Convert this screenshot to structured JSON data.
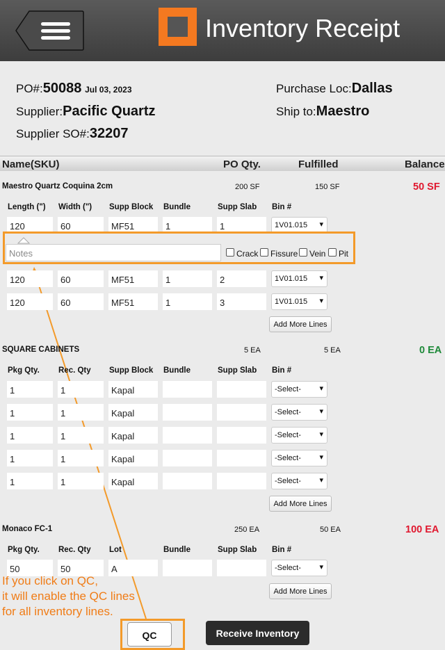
{
  "header": {
    "title": "Inventory Receipt",
    "menu_icon": "hamburger-icon",
    "logo": "square-logo"
  },
  "po": {
    "po_label": "PO#:",
    "po_number": "50088",
    "po_date": "Jul 03, 2023",
    "supplier_label": "Supplier:",
    "supplier": "Pacific Quartz",
    "supplier_so_label": "Supplier SO#:",
    "supplier_so": "32207",
    "purchase_loc_label": "Purchase Loc:",
    "purchase_loc": "Dallas",
    "ship_to_label": "Ship to:",
    "ship_to": "Maestro"
  },
  "table_header": {
    "name": "Name(SKU)",
    "po_qty": "PO Qty.",
    "fulfilled": "Fulfilled",
    "balance": "Balance"
  },
  "items": [
    {
      "name": "Maestro Quartz Coquina 2cm",
      "po_qty": "200 SF",
      "fulfilled": "150 SF",
      "balance": "50 SF",
      "cols": [
        "Length (\")",
        "Width (\")",
        "Supp Block",
        "Bundle",
        "Supp Slab",
        "Bin #"
      ],
      "rows": [
        [
          "120",
          "60",
          "MF51",
          "1",
          "1",
          "1V01.015"
        ],
        [
          "120",
          "60",
          "MF51",
          "1",
          "2",
          "1V01.015"
        ],
        [
          "120",
          "60",
          "MF51",
          "1",
          "3",
          "1V01.015"
        ]
      ],
      "add_label": "Add More Lines"
    },
    {
      "name": "SQUARE CABINETS",
      "po_qty": "5 EA",
      "fulfilled": "5 EA",
      "balance": "0 EA",
      "cols": [
        "Pkg Qty.",
        "Rec. Qty",
        "Supp Block",
        "Bundle",
        "Supp Slab",
        "Bin #"
      ],
      "rows": [
        [
          "1",
          "1",
          "Kapal",
          "",
          "",
          "-Select-"
        ],
        [
          "1",
          "1",
          "Kapal",
          "",
          "",
          "-Select-"
        ],
        [
          "1",
          "1",
          "Kapal",
          "",
          "",
          "-Select-"
        ],
        [
          "1",
          "1",
          "Kapal",
          "",
          "",
          "-Select-"
        ],
        [
          "1",
          "1",
          "Kapal",
          "",
          "",
          "-Select-"
        ]
      ],
      "add_label": "Add More Lines"
    },
    {
      "name": "Monaco FC-1",
      "po_qty": "250 EA",
      "fulfilled": "50 EA",
      "balance": "100 EA",
      "cols": [
        "Pkg Qty.",
        "Rec. Qty",
        "Lot",
        "Bundle",
        "Supp Slab",
        "Bin #"
      ],
      "rows": [
        [
          "50",
          "50",
          "A",
          "",
          "",
          "-Select-"
        ]
      ],
      "add_label": "Add More Lines"
    }
  ],
  "qc_line": {
    "notes_placeholder": "Notes",
    "checks": [
      "Crack",
      "Fissure",
      "Vein",
      "Pit"
    ]
  },
  "callout": [
    "If you click on QC,",
    "it will enable the QC lines",
    "for all inventory lines."
  ],
  "footer": {
    "qc_label": "QC",
    "receive_label": "Receive Inventory"
  },
  "colors": {
    "accent": "#f47920",
    "annotation": "#f39a2a",
    "balance_red": "#e0182f",
    "balance_green": "#1f8a3a"
  }
}
